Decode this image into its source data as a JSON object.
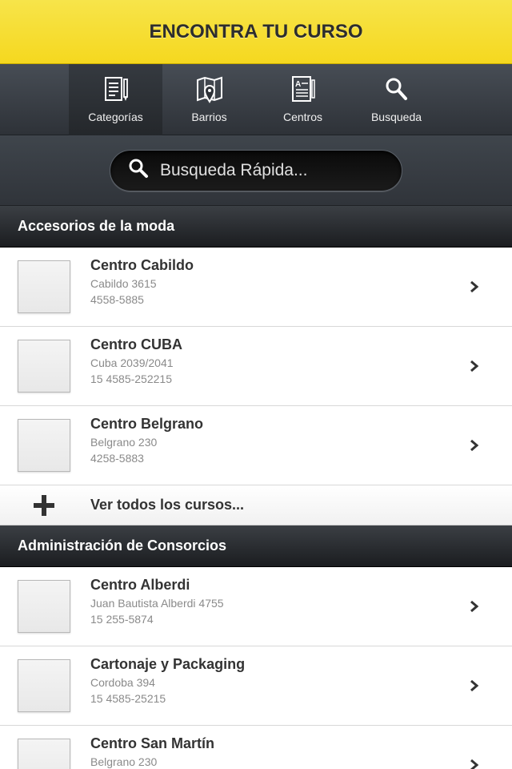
{
  "header": {
    "title": "ENCONTRA TU CURSO"
  },
  "tabs": [
    {
      "label": "Categorías",
      "icon": "document-pencil-icon",
      "active": true
    },
    {
      "label": "Barrios",
      "icon": "map-pin-icon",
      "active": false
    },
    {
      "label": "Centros",
      "icon": "building-list-icon",
      "active": false
    },
    {
      "label": "Busqueda",
      "icon": "search-icon",
      "active": false
    }
  ],
  "search": {
    "placeholder": "Busqueda Rápida..."
  },
  "sections": [
    {
      "title": "Accesorios de la moda",
      "items": [
        {
          "name": "Centro Cabildo",
          "address": "Cabildo 3615",
          "phone": "4558-5885"
        },
        {
          "name": "Centro CUBA",
          "address": "Cuba 2039/2041",
          "phone": "15 4585-252215"
        },
        {
          "name": "Centro Belgrano",
          "address": "Belgrano 230",
          "phone": "4258-5883"
        }
      ],
      "more_label": "Ver todos los cursos..."
    },
    {
      "title": "Administración de Consorcios",
      "items": [
        {
          "name": "Centro Alberdi",
          "address": "Juan Bautista Alberdi 4755",
          "phone": "15 255-5874"
        },
        {
          "name": "Cartonaje y Packaging",
          "address": "Cordoba 394",
          "phone": "15 4585-25215"
        },
        {
          "name": "Centro San Martín",
          "address": "Belgrano 230",
          "phone": ""
        }
      ]
    }
  ],
  "colors": {
    "header_yellow": "#f5d81f",
    "tabbar": "#2e3238",
    "text_dark": "#333333",
    "text_muted": "#8a8a8a"
  }
}
